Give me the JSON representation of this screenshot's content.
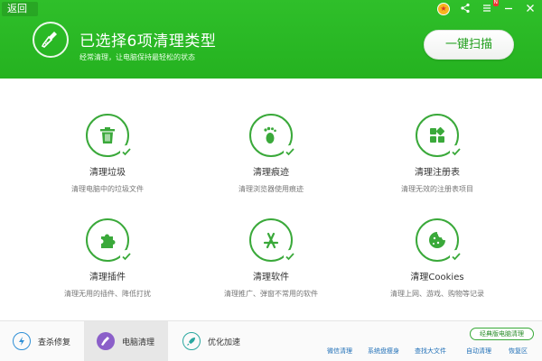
{
  "header": {
    "back_label": "返回",
    "title": "已选择6项清理类型",
    "subtitle": "经常清理，让电脑保持最轻松的状态",
    "scan_button": "一键扫描",
    "notification_badge": "N"
  },
  "items": [
    {
      "title": "清理垃圾",
      "desc": "清理电脑中的垃圾文件",
      "icon": "trash-icon"
    },
    {
      "title": "清理痕迹",
      "desc": "清理浏览器使用痕迹",
      "icon": "footprint-icon"
    },
    {
      "title": "清理注册表",
      "desc": "清理无效的注册表项目",
      "icon": "registry-icon"
    },
    {
      "title": "清理插件",
      "desc": "清理无用的插件、降低打扰",
      "icon": "puzzle-icon"
    },
    {
      "title": "清理软件",
      "desc": "清理推广、弹窗不常用的软件",
      "icon": "app-store-icon"
    },
    {
      "title": "清理Cookies",
      "desc": "清理上网、游戏、购物等记录",
      "icon": "cookie-icon"
    }
  ],
  "footer": {
    "tabs": [
      {
        "label": "查杀修复",
        "icon": "shield-bolt-icon",
        "active": false
      },
      {
        "label": "电脑清理",
        "icon": "broom-icon",
        "active": true
      },
      {
        "label": "优化加速",
        "icon": "rocket-icon",
        "active": false
      }
    ],
    "classic_button": "经典版电脑清理",
    "links": [
      "微信清理",
      "系统盘瘦身",
      "查找大文件",
      "自动清理",
      "恢复区"
    ]
  },
  "colors": {
    "brand_green": "#2fbf2a",
    "icon_green": "#3aa93a",
    "link_blue": "#1f6fb7"
  }
}
